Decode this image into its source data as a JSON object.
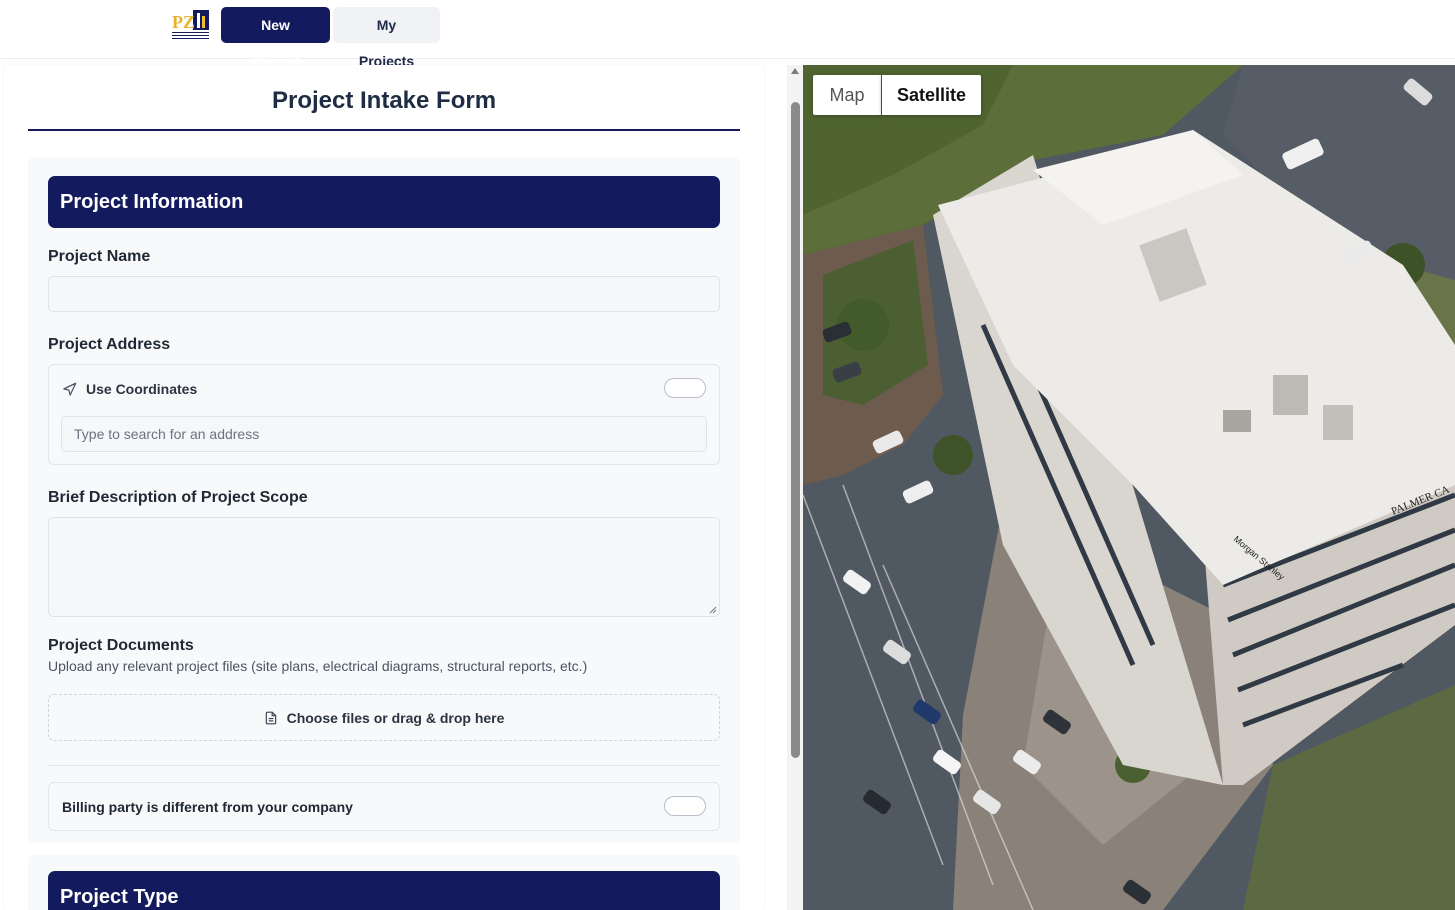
{
  "nav": {
    "new_project": "New Project",
    "my_projects": "My Projects",
    "logo_text": "PZ structural engineers"
  },
  "form": {
    "title": "Project Intake Form",
    "section_project_info": "Project Information",
    "project_name_label": "Project Name",
    "project_name_value": "",
    "project_address_label": "Project Address",
    "use_coordinates_label": "Use Coordinates",
    "use_coordinates_on": false,
    "address_placeholder": "Type to search for an address",
    "scope_label": "Brief Description of Project Scope",
    "scope_value": "",
    "documents_label": "Project Documents",
    "documents_help": "Upload any relevant project files (site plans, electrical diagrams, structural reports, etc.)",
    "dropzone_text": "Choose files or drag & drop here",
    "billing_label": "Billing party is different from your company",
    "billing_on": false,
    "section_project_type": "Project Type"
  },
  "map": {
    "map_tab": "Map",
    "satellite_tab": "Satellite",
    "active_tab": "Satellite",
    "sign_text_1": "PALMER CA",
    "sign_text_2": "Morgan Stanley"
  },
  "colors": {
    "brand_navy": "#141a5e",
    "card_bg": "#f8f9fb"
  }
}
